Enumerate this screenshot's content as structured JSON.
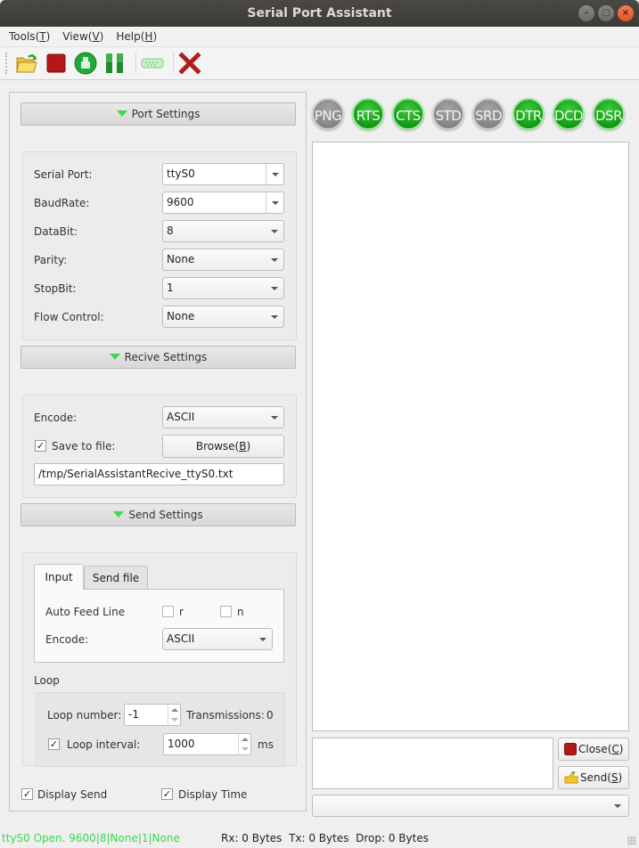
{
  "window": {
    "title": "Serial Port Assistant",
    "controls": [
      "minimize",
      "maximize",
      "close"
    ]
  },
  "menubar": {
    "items": [
      {
        "label": "Tools",
        "mnemonic": "T"
      },
      {
        "label": "View",
        "mnemonic": "V"
      },
      {
        "label": "Help",
        "mnemonic": "H"
      }
    ]
  },
  "toolbar": {
    "buttons": [
      {
        "name": "open-port",
        "icon": "folder-open-icon"
      },
      {
        "name": "close-port",
        "icon": "stop-square-icon"
      },
      {
        "name": "clear",
        "icon": "brush-clear-icon"
      },
      {
        "name": "pause",
        "icon": "pause-icon"
      },
      {
        "name": "port-connector",
        "icon": "serial-connector-icon"
      },
      {
        "name": "exit",
        "icon": "red-x-icon"
      }
    ]
  },
  "port_settings": {
    "header": "Port Settings",
    "fields": [
      {
        "label": "Serial Port:",
        "value": "ttyS0"
      },
      {
        "label": "BaudRate:",
        "value": "9600"
      },
      {
        "label": "DataBit:",
        "value": "8"
      },
      {
        "label": "Parity:",
        "value": "None"
      },
      {
        "label": "StopBit:",
        "value": "1"
      },
      {
        "label": "Flow Control:",
        "value": "None"
      }
    ]
  },
  "receive_settings": {
    "header": "Recive Settings",
    "encode_label": "Encode:",
    "encode_value": "ASCII",
    "save_to_file_label": "Save to file:",
    "save_to_file_checked": true,
    "browse_label": "Browse(B)",
    "browse_text": "Browse(",
    "browse_mnemonic": "B",
    "browse_suffix": ")",
    "file_path": "/tmp/SerialAssistantRecive_ttyS0.txt"
  },
  "send_settings": {
    "header": "Send Settings",
    "tabs": [
      {
        "label": "Input",
        "active": true
      },
      {
        "label": "Send file",
        "active": false
      }
    ],
    "auto_feed_line_label": "Auto Feed Line",
    "feed_r_label": "r",
    "feed_r_checked": false,
    "feed_n_label": "n",
    "feed_n_checked": false,
    "encode_label": "Encode:",
    "encode_value": "ASCII",
    "loop": {
      "title": "Loop",
      "loop_number_label": "Loop number:",
      "loop_number_value": "-1",
      "transmissions_label": "Transmissions:",
      "transmissions_value": "0",
      "loop_interval_label": "Loop interval:",
      "loop_interval_checked": true,
      "loop_interval_value": "1000",
      "loop_interval_unit": "ms"
    }
  },
  "display": {
    "display_send_label": "Display Send",
    "display_send_checked": true,
    "display_time_label": "Display Time",
    "display_time_checked": true
  },
  "signals": [
    {
      "label": "PNG",
      "state": "off"
    },
    {
      "label": "RTS",
      "state": "on"
    },
    {
      "label": "CTS",
      "state": "on"
    },
    {
      "label": "STD",
      "state": "off"
    },
    {
      "label": "SRD",
      "state": "off"
    },
    {
      "label": "DTR",
      "state": "on"
    },
    {
      "label": "DCD",
      "state": "on"
    },
    {
      "label": "DSR",
      "state": "on"
    }
  ],
  "colors": {
    "led_on": "#129a12",
    "led_off": "#858585",
    "status_ok": "#3ed94f",
    "section_triangle": "#3ed94f"
  },
  "receive_area": {
    "content": ""
  },
  "send_area": {
    "content": ""
  },
  "actions": {
    "close_text": "Close(",
    "close_mnemonic": "C",
    "close_suffix": ")",
    "send_text": "Send(",
    "send_mnemonic": "S",
    "send_suffix": ")"
  },
  "history_combo": {
    "value": ""
  },
  "statusbar": {
    "port_status": "ttyS0 Open. 9600|8|None|1|None",
    "rx": "Rx: 0 Bytes",
    "tx": "Tx: 0 Bytes",
    "drop": "Drop: 0 Bytes"
  }
}
